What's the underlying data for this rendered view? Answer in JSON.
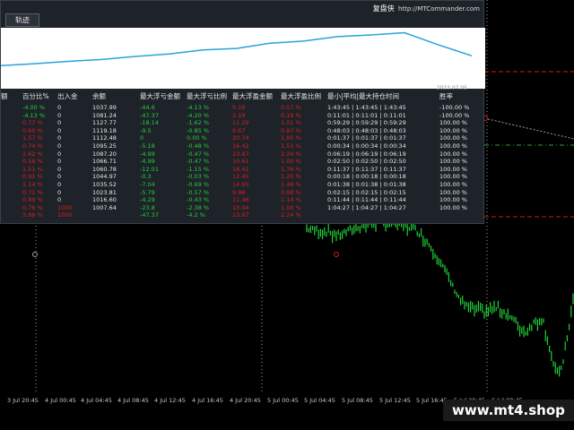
{
  "panel": {
    "brand_cn": "复盘侠",
    "brand_url": "http://MTCommander.com",
    "tab_label": "轨迹",
    "equity_date": "2023.07.05"
  },
  "table": {
    "headers": [
      "额",
      "百分比%",
      "出入金",
      "余额",
      "最大浮亏金额",
      "最大浮亏比例",
      "最大浮盈金额",
      "最大浮盈比例",
      "最小|平均|最大持仓时间",
      "胜率"
    ],
    "rows": [
      {
        "amt": "",
        "pct": "-4.00 %",
        "io": "0",
        "bal": "1037.99",
        "fl": "-44.6",
        "flp": "-4.13 %",
        "fp": "0.16",
        "fpp": "0.57 %",
        "time": "1:43:45 | 1:43:45 | 1:43:45",
        "win": "-100.00 %"
      },
      {
        "amt": "",
        "pct": "-4.13 %",
        "io": "0",
        "bal": "1081.24",
        "fl": "-47.37",
        "flp": "-4.20 %",
        "fp": "2.19",
        "fpp": "0.19 %",
        "time": "0:11:01 | 0:11:01 | 0:11:01",
        "win": "-100.00 %"
      },
      {
        "amt": "",
        "pct": "0.77 %",
        "io": "0",
        "bal": "1127.77",
        "fl": "-18.14",
        "flp": "-1.62 %",
        "fp": "11.29",
        "fpp": "1.01 %",
        "time": "0:59:29 | 0:59:29 | 0:59:29",
        "win": "100.00 %"
      },
      {
        "amt": "",
        "pct": "0.60 %",
        "io": "0",
        "bal": "1119.18",
        "fl": "-9.5",
        "flp": "-0.85 %",
        "fp": "9.67",
        "fpp": "0.87 %",
        "time": "0:48:03 | 0:48:03 | 0:48:03",
        "win": "100.00 %"
      },
      {
        "amt": "",
        "pct": "1.57 %",
        "io": "0",
        "bal": "1112.48",
        "fl": "0",
        "flp": "0.00 %",
        "fp": "20.74",
        "fpp": "1.85 %",
        "time": "0:01:37 | 0:01:37 | 0:01:37",
        "win": "100.00 %"
      },
      {
        "amt": "",
        "pct": "0.74 %",
        "io": "0",
        "bal": "1095.25",
        "fl": "-5.18",
        "flp": "-0.48 %",
        "fp": "16.42",
        "fpp": "1.51 %",
        "time": "0:00:34 | 0:00:34 | 0:00:34",
        "win": "100.00 %"
      },
      {
        "amt": "",
        "pct": "1.62 %",
        "io": "0",
        "bal": "1087.20",
        "fl": "-4.99",
        "flp": "-0.47 %",
        "fp": "23.87",
        "fpp": "2.24 %",
        "time": "0:06:19 | 0:06:19 | 0:06:19",
        "win": "100.00 %"
      },
      {
        "amt": "",
        "pct": "0.56 %",
        "io": "0",
        "bal": "1066.71",
        "fl": "-4.99",
        "flp": "-0.47 %",
        "fp": "10.61",
        "fpp": "1.00 %",
        "time": "0:02:50 | 0:02:50 | 0:02:50",
        "win": "100.00 %"
      },
      {
        "amt": "",
        "pct": "1.51 %",
        "io": "0",
        "bal": "1060.78",
        "fl": "-12.01",
        "flp": "-1.15 %",
        "fp": "18.41",
        "fpp": "1.76 %",
        "time": "0:11:37 | 0:11:37 | 0:11:37",
        "win": "100.00 %"
      },
      {
        "amt": "",
        "pct": "0.91 %",
        "io": "0",
        "bal": "1044.97",
        "fl": "-0.3",
        "flp": "-0.03 %",
        "fp": "12.45",
        "fpp": "1.20 %",
        "time": "0:00:18 | 0:00:18 | 0:00:18",
        "win": "100.00 %"
      },
      {
        "amt": "",
        "pct": "1.14 %",
        "io": "0",
        "bal": "1035.52",
        "fl": "-7.04",
        "flp": "-0.69 %",
        "fp": "14.95",
        "fpp": "1.46 %",
        "time": "0:01:38 | 0:01:38 | 0:01:38",
        "win": "100.00 %"
      },
      {
        "amt": "",
        "pct": "0.71 %",
        "io": "0",
        "bal": "1023.81",
        "fl": "-5.79",
        "flp": "-0.57 %",
        "fp": "9.98",
        "fpp": "0.98 %",
        "time": "0:02:15 | 0:02:15 | 0:02:15",
        "win": "100.00 %"
      },
      {
        "amt": "",
        "pct": "0.89 %",
        "io": "0",
        "bal": "1016.60",
        "fl": "-4.29",
        "flp": "-0.43 %",
        "fp": "11.46",
        "fpp": "1.14 %",
        "time": "0:11:44 | 0:11:44 | 0:11:44",
        "win": "100.00 %"
      },
      {
        "amt": "",
        "pct": "0.76 %",
        "io": "1000",
        "bal": "1007.64",
        "fl": "-23.8",
        "flp": "-2.38 %",
        "fp": "10.04",
        "fpp": "1.00 %",
        "time": "1:04:27 | 1:04:27 | 1:04:27",
        "win": "100.00 %"
      },
      {
        "amt": "",
        "pct": "3.88 %",
        "io": "1000",
        "bal": "",
        "fl": "-47.37",
        "flp": "-4.2 %",
        "fp": "23.87",
        "fpp": "2.24 %",
        "time": "",
        "win": ""
      }
    ]
  },
  "time_axis": {
    "labels": [
      "3 Jul 20:45",
      "4 Jul 00:45",
      "4 Jul 04:45",
      "4 Jul 08:45",
      "4 Jul 12:45",
      "4 Jul 16:45",
      "4 Jul 20:45",
      "5 Jul 00:45",
      "5 Jul 04:45",
      "5 Jul 08:45",
      "5 Jul 12:45",
      "5 Jul 16:45",
      "5 Jul 20:45",
      "6 Jul 00:45"
    ]
  },
  "watermark": "www.mt4.shop",
  "colors": {
    "panel_bg": "#1e2329",
    "equity_line": "#2aa3d9",
    "candle_up": "#1fd13a",
    "negative": "#e11b1b",
    "positive": "#1fd13a",
    "grid_dash": "#9aa0a6",
    "level_red": "#d11a1a",
    "level_green": "#2ea043"
  },
  "equity_series": [
    1000,
    1007.64,
    1016.6,
    1023.81,
    1035.52,
    1044.97,
    1060.78,
    1066.71,
    1087.2,
    1095.25,
    1112.48,
    1119.18,
    1127.77,
    1081.24,
    1037.99
  ]
}
